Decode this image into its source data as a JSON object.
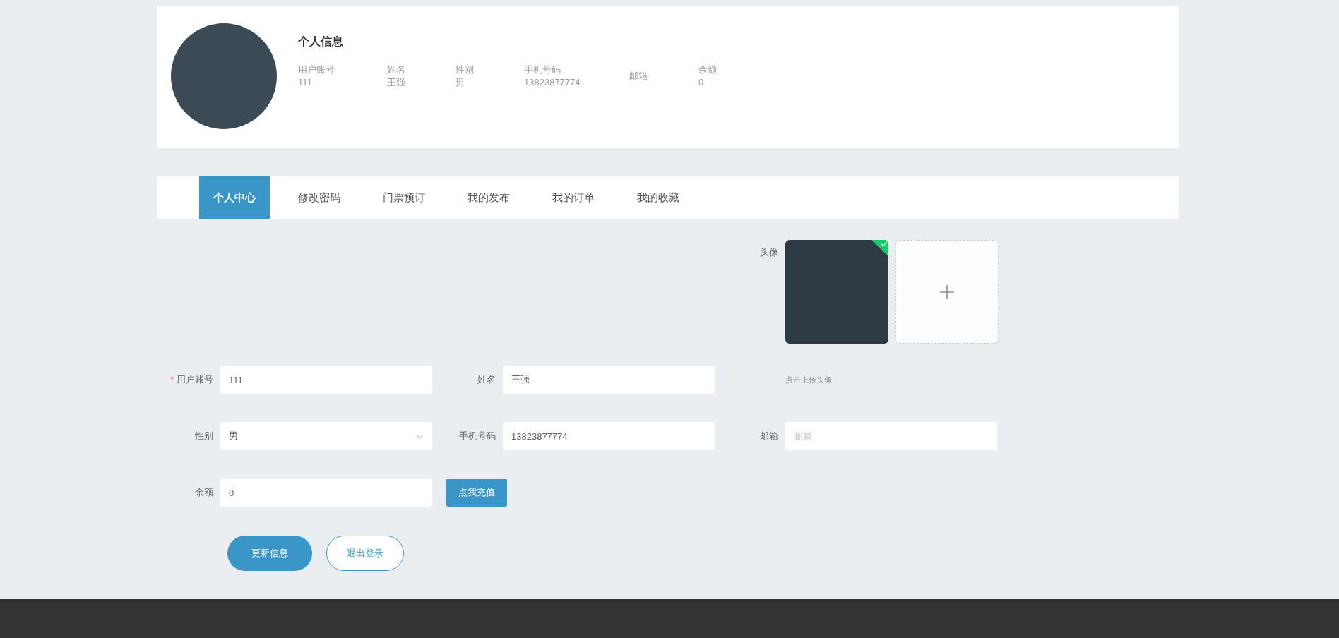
{
  "profile": {
    "title": "个人信息",
    "fields": [
      {
        "label": "用户账号",
        "value": "111"
      },
      {
        "label": "姓名",
        "value": "王强"
      },
      {
        "label": "性别",
        "value": "男"
      },
      {
        "label": "手机号码",
        "value": "13823877774"
      },
      {
        "label": "邮箱"
      },
      {
        "label": "余额",
        "value": "0"
      }
    ]
  },
  "tabs": [
    {
      "label": "个人中心",
      "selected": true
    },
    {
      "label": "修改密码",
      "selected": false
    },
    {
      "label": "门票预订",
      "selected": false
    },
    {
      "label": "我的发布",
      "selected": false
    },
    {
      "label": "我的订单",
      "selected": false
    },
    {
      "label": "我的收藏",
      "selected": false
    }
  ],
  "form": {
    "required_mark": "*",
    "avatar": {
      "label": "头像",
      "uploaded": true,
      "hint": "点击上传头像"
    },
    "rows": [
      [
        {
          "kind": "input",
          "label": "用户账号",
          "required": true,
          "value": "111"
        },
        {
          "kind": "input",
          "label": "姓名",
          "required": false,
          "value": "王强"
        },
        {
          "kind": "hint"
        }
      ],
      [
        {
          "kind": "select",
          "label": "性别",
          "required": false,
          "value": "男"
        },
        {
          "kind": "input",
          "label": "手机号码",
          "required": false,
          "value": "13823877774"
        },
        {
          "kind": "input",
          "label": "邮箱",
          "required": false,
          "placeholder": "邮箱"
        }
      ],
      [
        {
          "kind": "input",
          "label": "余额",
          "required": false,
          "value": "0"
        },
        {
          "kind": "button",
          "label": "点我充值"
        }
      ]
    ],
    "actions": [
      {
        "kind": "primary",
        "label": "更新信息"
      },
      {
        "kind": "outline",
        "label": "退出登录"
      }
    ]
  }
}
